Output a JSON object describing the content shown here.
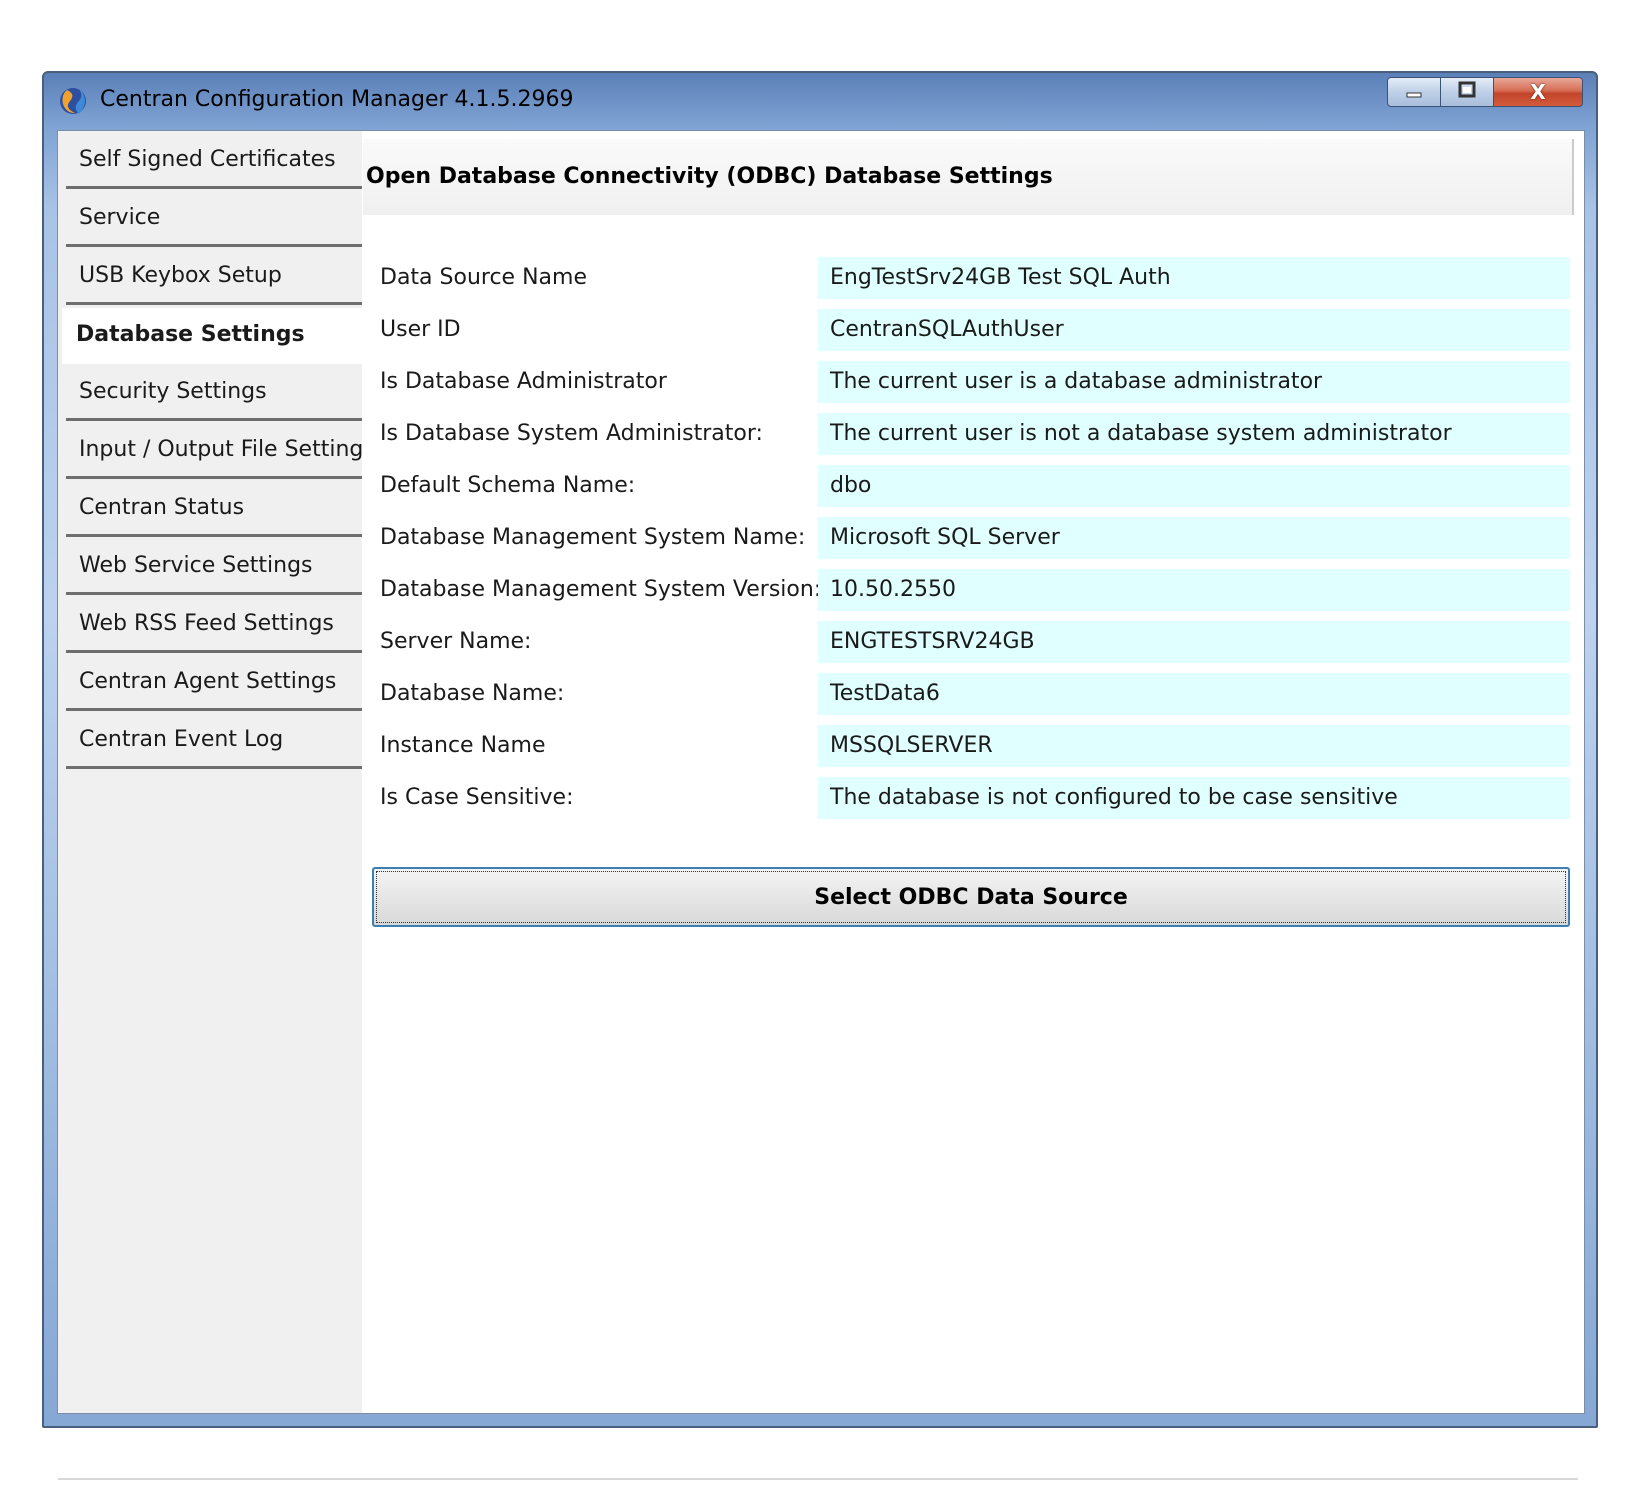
{
  "window": {
    "title": "Centran Configuration Manager 4.1.5.2969"
  },
  "controls": {
    "minimize_icon": "minimize-icon",
    "maximize_icon": "maximize-icon",
    "close_icon": "close-icon",
    "close_glyph": "X"
  },
  "sidebar": {
    "items": [
      {
        "label": "Self Signed Certificates"
      },
      {
        "label": "Service"
      },
      {
        "label": "USB Keybox Setup"
      },
      {
        "label": "Database Settings"
      },
      {
        "label": "Security Settings"
      },
      {
        "label": "Input / Output File Settings"
      },
      {
        "label": "Centran Status"
      },
      {
        "label": "Web Service Settings"
      },
      {
        "label": "Web RSS Feed Settings"
      },
      {
        "label": "Centran Agent Settings"
      },
      {
        "label": "Centran Event Log"
      }
    ],
    "active_index": 3
  },
  "main": {
    "header": "Open Database Connectivity (ODBC) Database Settings",
    "fields": [
      {
        "label": "Data Source Name",
        "value": "EngTestSrv24GB Test SQL Auth"
      },
      {
        "label": "User ID",
        "value": "CentranSQLAuthUser"
      },
      {
        "label": "Is Database Administrator",
        "value": "The current user is a database administrator"
      },
      {
        "label": "Is Database System Administrator:",
        "value": "The current user is not a database system administrator"
      },
      {
        "label": "Default Schema Name:",
        "value": "dbo"
      },
      {
        "label": "Database Management System Name:",
        "value": "Microsoft SQL Server"
      },
      {
        "label": "Database Management System Version:",
        "value": "10.50.2550"
      },
      {
        "label": "Server Name:",
        "value": "ENGTESTSRV24GB"
      },
      {
        "label": "Database Name:",
        "value": "TestData6"
      },
      {
        "label": "Instance Name",
        "value": "MSSQLSERVER"
      },
      {
        "label": "Is Case Sensitive:",
        "value": "The database is not configured to be case sensitive"
      }
    ],
    "select_button_label": "Select ODBC Data Source"
  },
  "colors": {
    "value_background": "#e0ffff",
    "titlebar": "#7fa3d3",
    "close_button": "#c2452a",
    "focus_border": "#3c7fb1"
  }
}
